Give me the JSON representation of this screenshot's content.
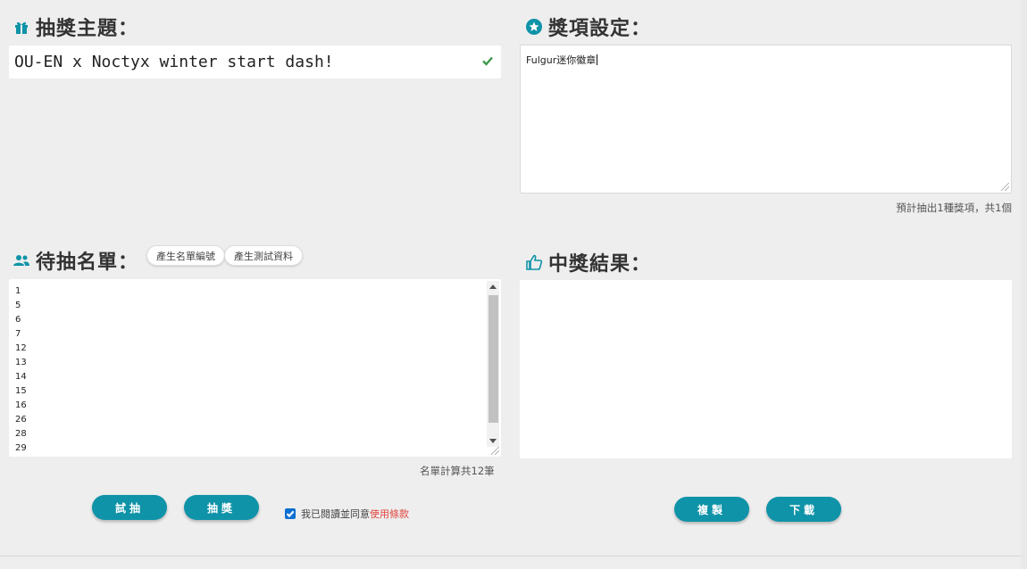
{
  "headings": {
    "theme": "抽獎主題：",
    "prizes": "獎項設定：",
    "list": "待抽名單：",
    "results": "中獎結果："
  },
  "theme": {
    "value": "OU-EN x Noctyx winter start dash!"
  },
  "prizes": {
    "value": "Fulgur迷你徽章",
    "summary": "預計抽出1種獎項，共1個"
  },
  "list": {
    "generate_button": "產生名單編號",
    "test_data_button": "產生測試資料",
    "entries": [
      "1",
      "5",
      "6",
      "7",
      "12",
      "13",
      "14",
      "15",
      "16",
      "26",
      "28",
      "29"
    ],
    "count_text": "名單計算共12筆"
  },
  "actions": {
    "trial": "試抽",
    "draw": "抽獎",
    "copy": "複製",
    "download": "下載",
    "agree_text": "我已閱讀並同意",
    "terms_link": "使用條款"
  },
  "colors": {
    "accent": "#0f93a8",
    "link": "#e0443e",
    "checkbox": "#0b6fd1"
  },
  "icons": {
    "theme": "gift-icon",
    "prizes": "star-circle-icon",
    "list": "people-icon",
    "results": "thumbs-up-icon",
    "theme_status": "check-icon"
  }
}
